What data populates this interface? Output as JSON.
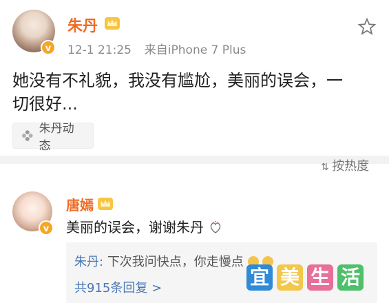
{
  "post": {
    "author": "朱丹",
    "time": "12-1 21:25",
    "source": "来自iPhone 7 Plus",
    "text_line1": "她没有不礼貌，我没有尴尬，美丽的误会，一",
    "text_line2": "切很好...",
    "topic_tag": "朱丹动态"
  },
  "comments_header": {
    "sort_label": "按热度"
  },
  "comment": {
    "author": "唐嫣",
    "text": "美丽的误会，谢谢朱丹",
    "reply_name": "朱丹:",
    "reply_text": "下次我问快点，你走慢点",
    "more_replies": "共915条回复 >"
  },
  "watermark": [
    "宜",
    "美",
    "生",
    "活"
  ],
  "colors": {
    "accent_name": "#f06c24",
    "link": "#4a78b4",
    "verified": "#f5a623"
  }
}
